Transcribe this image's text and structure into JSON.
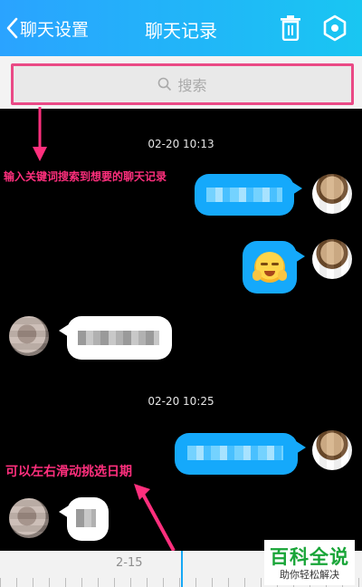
{
  "header": {
    "back_label": "聊天设置",
    "title": "聊天记录"
  },
  "search": {
    "placeholder": "搜索"
  },
  "messages": {
    "time_1": "02-20 10:13",
    "time_2": "02-20 10:25"
  },
  "annotations": {
    "search_hint": "输入关键词搜索到想要的聊天记录",
    "date_hint": "可以左右滑动挑选日期"
  },
  "timeline": {
    "date_label": "2-15"
  },
  "watermark": {
    "title": "百科全说",
    "subtitle": "助你轻松解决"
  },
  "colors": {
    "header": "#1fb2f8",
    "bubble": "#15a9fb",
    "annotation": "#ff2f7d",
    "watermark": "#19a538"
  },
  "icons": [
    "chevron-left-icon",
    "trash-icon",
    "settings-hex-icon",
    "search-icon",
    "arrow-icon",
    "laugh-cry-emoji"
  ]
}
